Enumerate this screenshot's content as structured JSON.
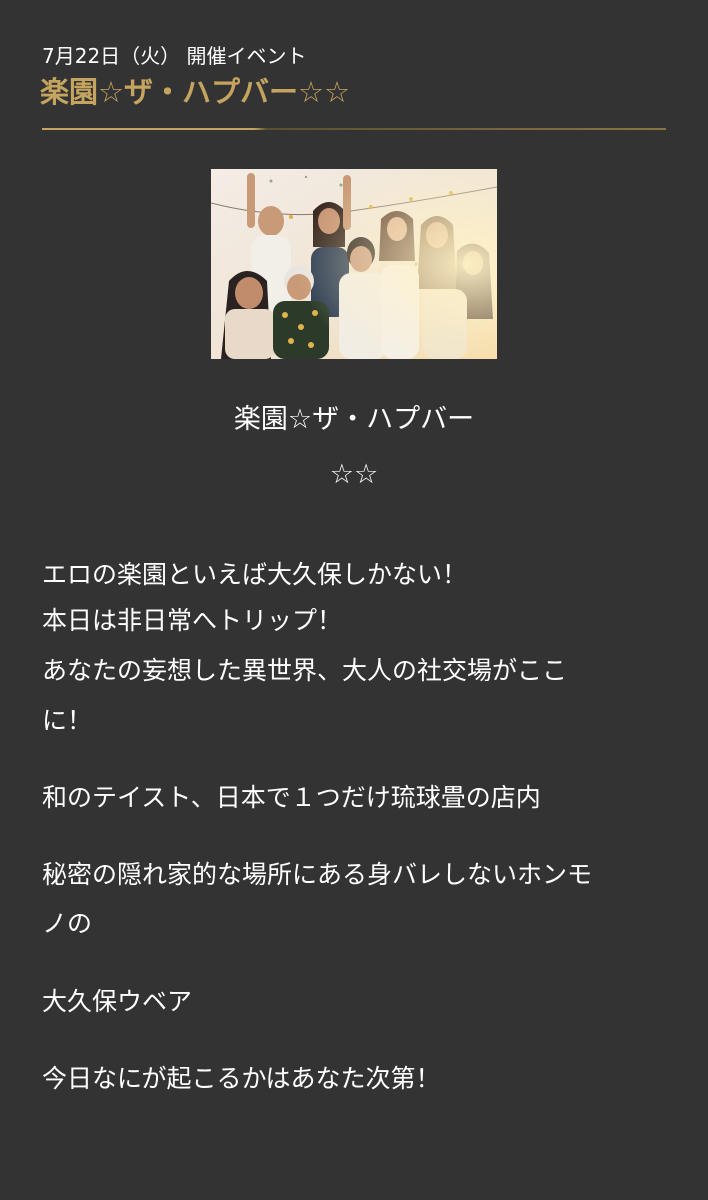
{
  "event": {
    "date_line": "7月22日（火） 開催イベント",
    "title": "楽園☆ザ・ハプバー☆☆"
  },
  "colors": {
    "background": "#333333",
    "accent_gold": "#c4a45e",
    "text": "#ffffff"
  },
  "content": {
    "subtitle_line1": "楽園☆ザ・ハプバー",
    "subtitle_line2": "☆☆",
    "paragraphs": [
      "エロの楽園といえば大久保しかない！",
      "本日は非日常へトリップ！",
      "あなたの妄想した異世界、大人の社交場がここ",
      "に！",
      "和のテイスト、日本で１つだけ琉球畳の店内",
      "秘密の隠れ家的な場所にある身バレしないホンモ",
      "ノの",
      "大久保ウベア",
      "今日なにが起こるかはあなた次第！"
    ]
  }
}
